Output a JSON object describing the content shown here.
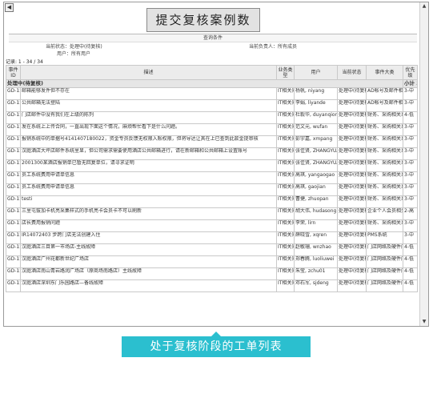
{
  "page_title": "提交复核案例数",
  "query_label": "查询条件",
  "filters": {
    "current_status": "当前状态：处理中(待复核)",
    "current_owner": "当前负责人：所有成员",
    "user": "用户：所有用户"
  },
  "record_count": "记录: 1 - 34 / 34",
  "columns": [
    "事件ID",
    "描述",
    "业务类型",
    "用户",
    "当前状态",
    "事件大类",
    "优先级"
  ],
  "group": {
    "label": "处理中(待复核)",
    "subtotal_label": "小计",
    "subtotal": "34"
  },
  "rows": [
    {
      "id": "GD-1588",
      "desc": "邮箱能够发件但不存在",
      "type": "IT相关问题",
      "user": "杨帆, niyang",
      "status": "处理中(待复核)",
      "category": "AD帐号及邮件相关",
      "priority": "3-中"
    },
    {
      "id": "GD-1587",
      "desc": "公共邮箱无法登陆",
      "type": "IT相关问题",
      "user": "李娟, liyande",
      "status": "处理中(待复核)",
      "category": "AD帐号及邮件相关",
      "priority": "3-中"
    },
    {
      "id": "GD-1586",
      "desc": "门店邮件中没有我们在上级的陈列",
      "type": "IT相关问题",
      "user": "杜毅华, duyanqiong",
      "status": "处理中(待复核)",
      "category": "财务、采购相关系统",
      "priority": "4-低"
    },
    {
      "id": "GD-1585",
      "desc": "发在系统上上传合同，一直出现下面这个情况，麻烦帮忙看下是什么问题。",
      "type": "IT相关问题",
      "user": "范文元, wufan",
      "status": "处理中(待复核)",
      "category": "财务、采购相关系统",
      "priority": "3-中"
    },
    {
      "id": "GD-1583",
      "desc": "报销系统中的单据号4141407180022，资金专员反馈无权限入账权限，但将导达让其在上已查到此款金提审核",
      "type": "IT相关问题",
      "user": "彭宇嘉, xmpang",
      "status": "处理中(待复核)",
      "category": "财务、采购相关系统",
      "priority": "3-中"
    },
    {
      "id": "GD-1582",
      "desc": "汉庭酒店大坪店邮件系统里显，但公司需求需要使用酒店公共邮箱进行，请在新邮箱和公共邮箱上设置账号",
      "type": "IT相关问题",
      "user": "张佳贤, ZHANGYUANHONG",
      "status": "处理中(待复核)",
      "category": "财务、采购相关系统",
      "priority": "3-中"
    },
    {
      "id": "GD-1581",
      "desc": "2001300某酒店报销单已暂无回复单位，请寻求证明",
      "type": "IT相关问题",
      "user": "张佳贤, ZHANGYUANHONG",
      "status": "处理中(待复核)",
      "category": "财务、采购相关系统",
      "priority": "3-中"
    },
    {
      "id": "GD-1577",
      "desc": "员工系统费用申请单信息",
      "type": "IT相关问题",
      "user": "高琪, yangaogao",
      "status": "处理中(待复核)",
      "category": "财务、采购相关系统",
      "priority": "3-中"
    },
    {
      "id": "GD-1575",
      "desc": "员工系统费用申请单信息",
      "type": "IT相关问题",
      "user": "高琪, gaojian",
      "status": "处理中(待复核)",
      "category": "财务、采购相关系统",
      "priority": "3-中"
    },
    {
      "id": "GD-1571",
      "desc": "testi",
      "type": "IT相关问题",
      "user": "曹捷, zhuopan",
      "status": "处理中(待复核)",
      "category": "财务、采购相关系统",
      "priority": "3-中"
    },
    {
      "id": "GD-1566",
      "desc": "三里屯拔加卡机亮采集样式的手机亮卡会员卡不可以刷新",
      "type": "IT相关问题",
      "user": "胡大伟, hudasong",
      "status": "处理中(待复核)",
      "category": "企业个人会员相关系统",
      "priority": "2-高"
    },
    {
      "id": "GD-1558",
      "desc": "店长费用报销问题",
      "type": "IT相关问题",
      "user": "李荣, lirn",
      "status": "处理中(待复核)",
      "category": "财务、采购相关系统",
      "priority": "3-中"
    },
    {
      "id": "GD-1544",
      "desc": "IR14072403 步跨门店无法创建入住",
      "type": "IT相关问题",
      "user": "薛晓雪, xqren",
      "status": "处理中(待复核)",
      "category": "PMS系统",
      "priority": "3-中"
    },
    {
      "id": "GD-1543",
      "desc": "汉庭酒店三目第一市场店-主线故障",
      "type": "IT相关问题",
      "user": "赵敏珊, wnzhao",
      "status": "处理中(待复核)",
      "category": "门店网络及硬件问题",
      "priority": "4-低"
    },
    {
      "id": "GD-1536",
      "desc": "汉庭酒店广州花都新世纪广场店",
      "type": "IT相关问题",
      "user": "郑春腾, luoliuwei",
      "status": "处理中(待复核)",
      "category": "门店网络及硬件问题",
      "priority": "4-低"
    },
    {
      "id": "GD-1535",
      "desc": "汉庭酒店南山青岩路润广场店（原商场南路店）主线故障",
      "type": "IT相关问题",
      "user": "朱莹, zchu01",
      "status": "处理中(待复核)",
      "category": "门店网络及硬件问题",
      "priority": "4-低"
    },
    {
      "id": "GD-1534",
      "desc": "汉庭酒店深圳东门乐园路店—备线故障",
      "type": "IT相关问题",
      "user": "邓石军, sjdeng",
      "status": "处理中(待复核)",
      "category": "门店网络及硬件问题",
      "priority": "4-低"
    }
  ],
  "caption": "处于复核阶段的工单列表",
  "colors": {
    "caption_bg": "#2bbfcf",
    "title_bg": "#e2e2e2",
    "group_bg": "#e6e6e6"
  }
}
